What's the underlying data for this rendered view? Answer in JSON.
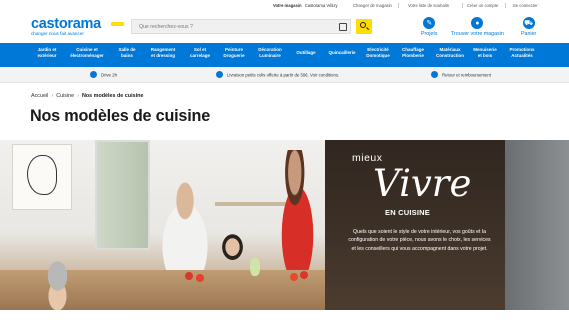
{
  "topbar": {
    "store_label": "Votre magasin",
    "store_value": "Castorama Vélizy",
    "change_store": "Changer de magasin",
    "wishlist": "Votre liste de souhaits",
    "create_account": "Créer un compte",
    "login": "Se connecter"
  },
  "header": {
    "logo_text": "castorama",
    "logo_tagline": "changer nous fait avancer",
    "search_placeholder": "Que recherchez-vous ?",
    "icons": [
      {
        "label": "Projets",
        "icon": "projects-icon"
      },
      {
        "label": "Trouver votre magasin",
        "icon": "store-locator-icon"
      },
      {
        "label": "Panier",
        "icon": "cart-icon"
      }
    ]
  },
  "nav": {
    "items": [
      "Jardin et\nextérieur",
      "Cuisine et\nélectroménager",
      "Salle de\nbains",
      "Rangement\net dressing",
      "Sol et\ncarrelage",
      "Peinture\nDroguerie",
      "Décoration\nLuminaire",
      "Outillage",
      "Quincaillerie",
      "Electricité\nDomotique",
      "Chauffage\nPlomberie",
      "Matériaux\nConstruction",
      "Menuiserie\net bois",
      "Promotions\nActualités"
    ]
  },
  "services": [
    {
      "label": "Drive 2h",
      "icon": "drive-icon"
    },
    {
      "label": "Livraison petits colis offerte à partir de 50€. Voir conditions.",
      "icon": "delivery-icon"
    },
    {
      "label": "Retour et remboursement",
      "icon": "return-icon"
    }
  ],
  "breadcrumb": {
    "items": [
      "Accueil",
      "Cuisine"
    ],
    "current": "Nos modèles de cuisine"
  },
  "page_title": "Nos modèles de cuisine",
  "hero": {
    "mieux": "mieux",
    "vivre": "Vivre",
    "en_cuisine": "EN CUISINE",
    "description": "Quels que soient le style de votre intérieur, vos goûts et la configuration de votre pièce, nous avons le choix, les services et les conseillers qui vous accompagnent dans votre projet."
  },
  "colors": {
    "brand_blue": "#0078d7",
    "brand_yellow": "#ffdd00"
  }
}
